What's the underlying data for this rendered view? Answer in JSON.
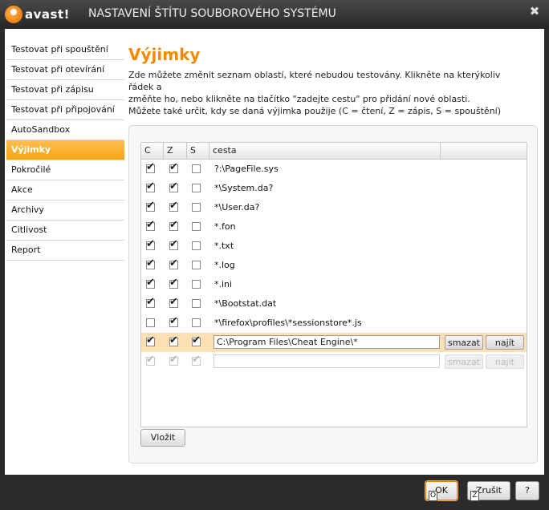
{
  "window": {
    "logo_text": "avast!",
    "title": "NASTAVENÍ ŠTÍTU SOUBOROVÉHO SYSTÉMU",
    "close_glyph": "✖"
  },
  "sidebar": {
    "items": [
      {
        "label": "Testovat při spouštění"
      },
      {
        "label": "Testovat při otevírání"
      },
      {
        "label": "Testovat při zápisu"
      },
      {
        "label": "Testovat při připojování"
      },
      {
        "label": "AutoSandbox"
      },
      {
        "label": "Výjimky"
      },
      {
        "label": "Pokročilé"
      },
      {
        "label": "Akce"
      },
      {
        "label": "Archivy"
      },
      {
        "label": "Citlivost"
      },
      {
        "label": "Report"
      }
    ],
    "active_label": "Výjimky"
  },
  "main": {
    "title": "Výjimky",
    "desc1": "Zde můžete změnit seznam oblastí, které nebudou testovány. Klikněte na kterýkoliv řádek a",
    "desc2": "změňte ho, nebo klikněte na tlačítko \"zadejte cestu\" pro přidání nové oblasti.",
    "desc3": "Můžete také určit, kdy se daná výjimka použije (C = čtení, Z = zápis, S = spouštění)"
  },
  "table": {
    "headers": {
      "c": "C",
      "z": "Z",
      "s": "S",
      "cesta": "cesta"
    },
    "rows": [
      {
        "c": true,
        "z": true,
        "s": false,
        "path": "?:\\PageFile.sys"
      },
      {
        "c": true,
        "z": true,
        "s": false,
        "path": "*\\System.da?"
      },
      {
        "c": true,
        "z": true,
        "s": false,
        "path": "*\\User.da?"
      },
      {
        "c": true,
        "z": true,
        "s": false,
        "path": "*.fon"
      },
      {
        "c": true,
        "z": true,
        "s": false,
        "path": "*.txt"
      },
      {
        "c": true,
        "z": true,
        "s": false,
        "path": "*.log"
      },
      {
        "c": true,
        "z": true,
        "s": false,
        "path": "*.ini"
      },
      {
        "c": true,
        "z": true,
        "s": false,
        "path": "*\\Bootstat.dat"
      },
      {
        "c": false,
        "z": true,
        "s": false,
        "path": "*\\firefox\\profiles\\*sessionstore*.js"
      }
    ],
    "editing_row": {
      "c": true,
      "z": true,
      "s": true,
      "path": "C:\\Program Files\\Cheat Engine\\*"
    },
    "new_row": {
      "c": true,
      "z": true,
      "s": true,
      "path": ""
    },
    "smazat_label": "smazat",
    "najit_label": "najít"
  },
  "buttons": {
    "insert": "Vložit",
    "ok": "OK",
    "ok_hotkey": "O",
    "cancel": "Zrušit",
    "cancel_hotkey": "Z",
    "help": "?"
  }
}
